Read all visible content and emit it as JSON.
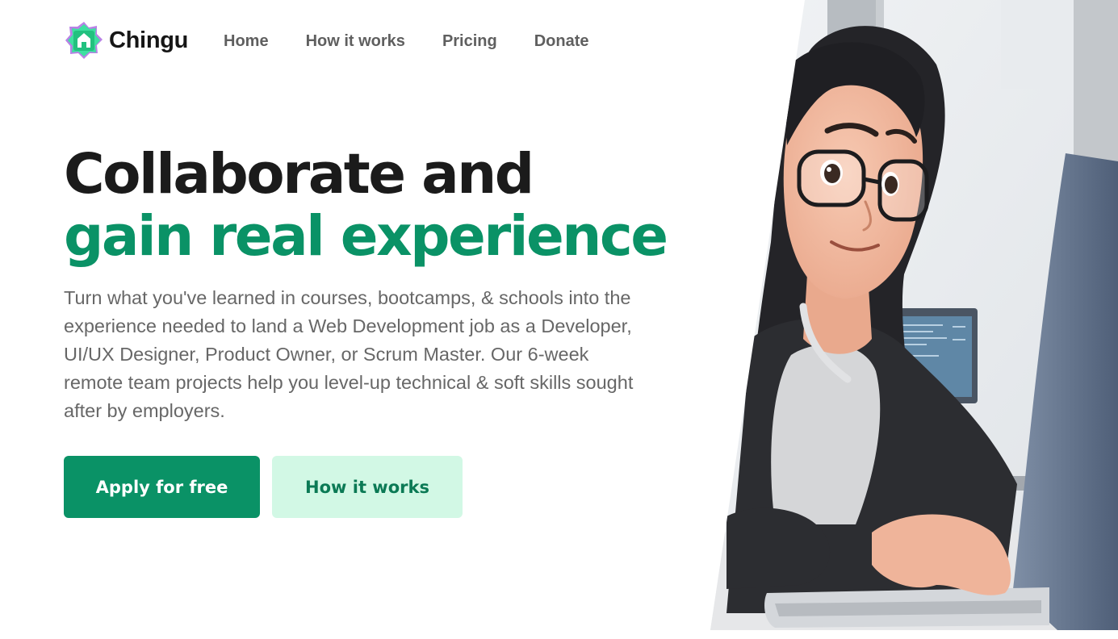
{
  "brand": {
    "name": "Chingu"
  },
  "nav": {
    "items": [
      {
        "label": "Home"
      },
      {
        "label": "How it works"
      },
      {
        "label": "Pricing"
      },
      {
        "label": "Donate"
      }
    ]
  },
  "hero": {
    "title_line1": "Collaborate and",
    "title_line2": "gain real experience",
    "description": "Turn what you've learned in courses, bootcamps, & schools into the experience needed to land a Web Development job as a Developer, UI/UX Designer, Product Owner, or Scrum Master. Our 6-week remote team projects help you level-up technical & soft skills sought after by employers.",
    "primary_button": "Apply for free",
    "secondary_button": "How it works"
  },
  "colors": {
    "accent": "#0a9266",
    "accent_light": "#d2f8e5",
    "heading": "#1b1b1b",
    "body_text": "#676767"
  },
  "icons": [
    "chingu-logo-icon"
  ]
}
